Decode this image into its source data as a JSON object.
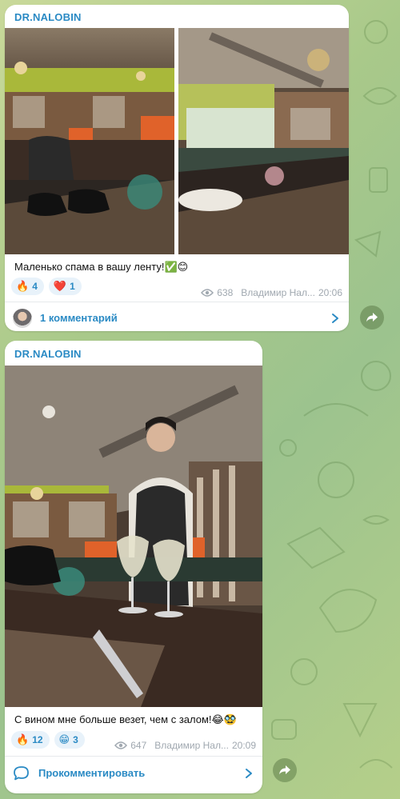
{
  "posts": [
    {
      "channel": "DR.NALOBIN",
      "caption": "Маленько спама в вашу ленту!✅😊",
      "reactions": [
        {
          "emoji": "🔥",
          "count": "4"
        },
        {
          "emoji": "❤️",
          "count": "1"
        }
      ],
      "views": "638",
      "author": "Владимир Нал...",
      "time": "20:06",
      "comments_label": "1 комментарий"
    },
    {
      "channel": "DR.NALOBIN",
      "caption": "С вином мне больше везет, чем с залом!😂🥸",
      "reactions": [
        {
          "emoji": "🔥",
          "count": "12"
        },
        {
          "emoji": "😁",
          "count": "3"
        }
      ],
      "views": "647",
      "author": "Владимир Нал...",
      "time": "20:09",
      "comments_label": "Прокомментировать"
    }
  ],
  "colors": {
    "accent": "#2a8ac4",
    "meta": "#a0a8b0",
    "reaction_bg": "#e8f2fa",
    "wallpaper": "#a9c98a"
  }
}
